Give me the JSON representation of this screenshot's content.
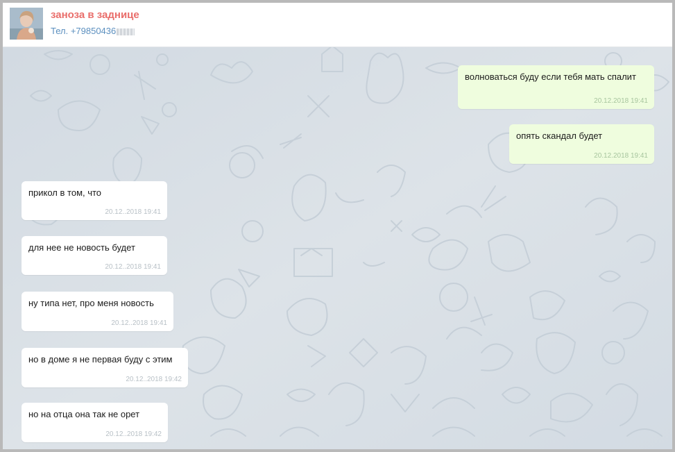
{
  "contact": {
    "name": "заноза в заднице",
    "phone": "Тел. +79850436"
  },
  "messages": [
    {
      "direction": "outgoing",
      "text": "волноваться буду если тебя мать спалит",
      "time": "20.12.2018 19:41"
    },
    {
      "direction": "outgoing",
      "text": "опять скандал будет",
      "time": "20.12.2018 19:41"
    },
    {
      "direction": "incoming",
      "text": "прикол в том, что",
      "time": "20.12..2018 19:41"
    },
    {
      "direction": "incoming",
      "text": "для нее не новость будет",
      "time": "20.12..2018 19:41"
    },
    {
      "direction": "incoming",
      "text": "ну типа нет, про меня новость",
      "time": "20.12..2018 19:41"
    },
    {
      "direction": "incoming",
      "text": "но в доме я не первая буду с этим",
      "time": "20.12..2018 19:42"
    },
    {
      "direction": "incoming",
      "text": "но на отца она так не орет",
      "time": "20.12..2018 19:42"
    }
  ],
  "colors": {
    "contact_name": "#e96d6a",
    "contact_phone": "#5b8fbf",
    "chat_background": "#d5dde4",
    "outgoing_bubble": "#effdde",
    "incoming_bubble": "#ffffff"
  },
  "icons": {
    "avatar": "avatar-photo",
    "background": "chat-doodle-pattern"
  }
}
